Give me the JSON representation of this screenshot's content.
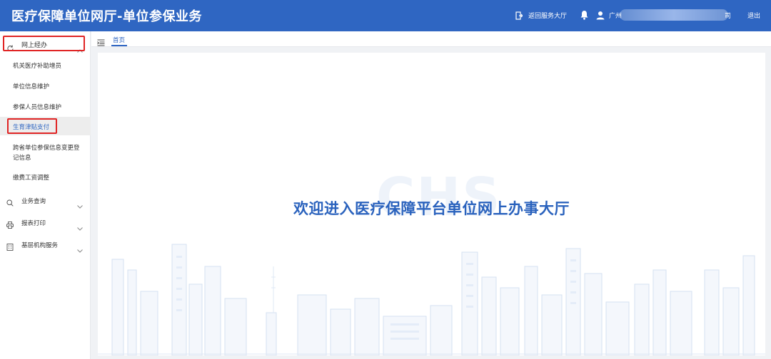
{
  "header": {
    "title": "医疗保障单位网厅-单位参保业务",
    "return_label": "返回服务大厅",
    "user_prefix": "广州",
    "user_suffix": "司",
    "logout_label": "退出"
  },
  "sidebar": {
    "top_menu": "网上经办",
    "sub_items": [
      "机关医疗补助增员",
      "单位信息维护",
      "参保人员信息维护",
      "生育津贴支付",
      "跨省单位参保信息变更登记信息",
      "缴费工资调整"
    ],
    "groups": [
      "业务查询",
      "报表打印",
      "基层机构服务"
    ]
  },
  "tabs": {
    "home_label": "首页"
  },
  "main": {
    "welcome_text": "欢迎进入医疗保障平台单位网上办事大厅",
    "watermark": "CHS"
  },
  "colors": {
    "brand": "#2f66c2",
    "highlight": "#e02424"
  }
}
